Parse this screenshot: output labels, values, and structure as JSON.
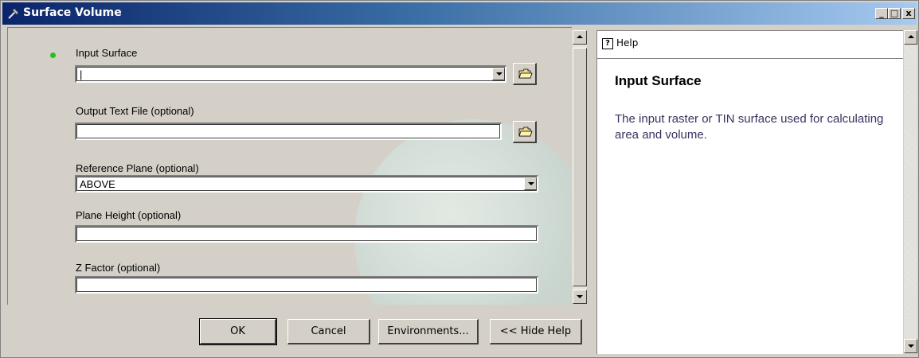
{
  "window": {
    "title": "Surface Volume",
    "controls": {
      "minimize": "_",
      "maximize": "□",
      "close": "x"
    }
  },
  "params": {
    "input_surface": {
      "label": "Input Surface",
      "value": "|",
      "required": true
    },
    "output_text_file": {
      "label": "Output Text File (optional)",
      "value": ""
    },
    "reference_plane": {
      "label": "Reference Plane (optional)",
      "value": "ABOVE"
    },
    "plane_height": {
      "label": "Plane Height (optional)",
      "value": ""
    },
    "z_factor": {
      "label": "Z Factor (optional)",
      "value": ""
    }
  },
  "buttons": {
    "ok": "OK",
    "cancel": "Cancel",
    "environments": "Environments...",
    "hide_help": "<< Hide Help"
  },
  "help": {
    "tab_label": "Help",
    "icon": "help-icon",
    "title": "Input Surface",
    "description": "The input raster or TIN surface used for calculating area and volume."
  },
  "colors": {
    "title_bar_start": "#0a246a",
    "title_bar_end": "#a6caf0",
    "required_dot": "#22c022",
    "help_text": "#3b3162"
  }
}
